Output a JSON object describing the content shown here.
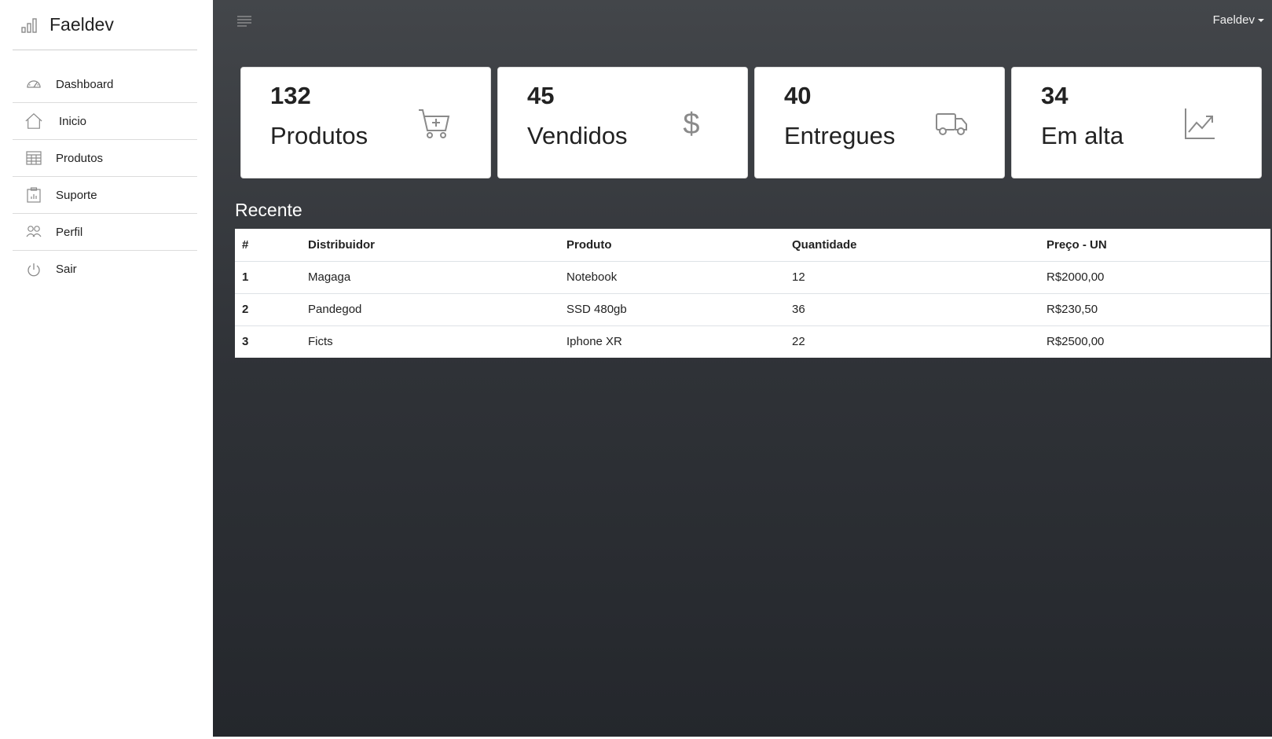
{
  "brand": {
    "title": "Faeldev",
    "icon": "bar-chart-icon"
  },
  "sidebar": {
    "items": [
      {
        "label": "Dashboard",
        "icon": "speedometer-icon"
      },
      {
        "label": "Inicio",
        "icon": "home-icon"
      },
      {
        "label": "Produtos",
        "icon": "table-icon"
      },
      {
        "label": "Suporte",
        "icon": "clipboard-data-icon"
      },
      {
        "label": "Perfil",
        "icon": "people-icon"
      },
      {
        "label": "Sair",
        "icon": "power-icon"
      }
    ]
  },
  "topbar": {
    "user_label": "Faeldev",
    "menu_icon": "hamburger-icon"
  },
  "cards": [
    {
      "value": "132",
      "label": "Produtos",
      "icon": "cart-plus-icon"
    },
    {
      "value": "45",
      "label": "Vendidos",
      "icon": "dollar-icon"
    },
    {
      "value": "40",
      "label": "Entregues",
      "icon": "truck-icon"
    },
    {
      "value": "34",
      "label": "Em alta",
      "icon": "graph-up-icon"
    }
  ],
  "recent": {
    "title": "Recente",
    "columns": [
      "#",
      "Distribuidor",
      "Produto",
      "Quantidade",
      "Preço - UN"
    ],
    "rows": [
      [
        "1",
        "Magaga",
        "Notebook",
        "12",
        "R$2000,00"
      ],
      [
        "2",
        "Pandegod",
        "SSD 480gb",
        "36",
        "R$230,50"
      ],
      [
        "3",
        "Ficts",
        "Iphone XR",
        "22",
        "R$2500,00"
      ]
    ]
  },
  "colors": {
    "main_bg_top": "#43464a",
    "main_bg_bottom": "#24272c",
    "icon_gray": "#8a8a8a"
  }
}
